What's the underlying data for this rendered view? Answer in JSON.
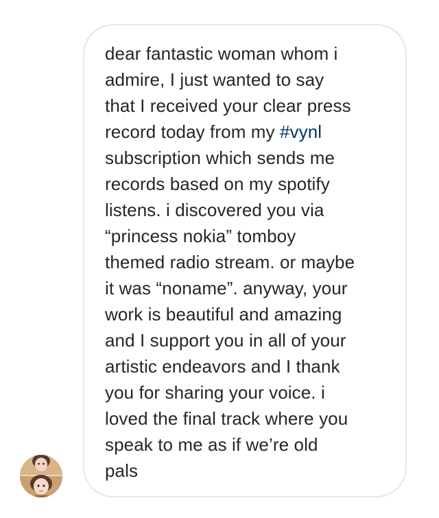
{
  "message": {
    "lines": [
      "dear fantastic woman whom i",
      "admire, I just wanted to say",
      "that I received your clear press",
      "record today from my ",
      "subscription which sends me",
      "records based on my spotify",
      "listens. i discovered you via",
      "“princess nokia” tomboy",
      "themed radio stream. or maybe",
      "it was “noname”.  anyway, your",
      "work is beautiful and amazing",
      "and I support you in all of your",
      "artistic endeavors and I thank",
      "you for sharing your voice. i",
      "loved the final track where you",
      "speak to me as if we’re old",
      "pals"
    ],
    "hashtag": "#vynl"
  },
  "colors": {
    "text": "#262626",
    "hashtag": "#003569",
    "bubble_border": "#e6e6e6",
    "background": "#ffffff"
  },
  "avatar": {
    "icon": "profile-photo-avatar"
  }
}
